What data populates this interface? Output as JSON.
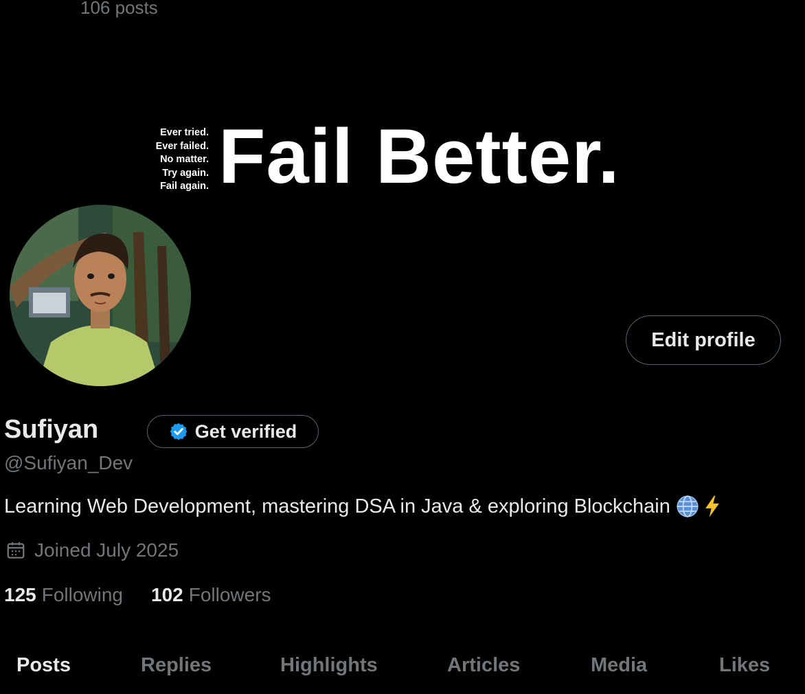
{
  "header": {
    "post_count": "106 posts"
  },
  "banner": {
    "small_lines": [
      "Ever tried.",
      "Ever failed.",
      "No matter.",
      "Try again.",
      "Fail again."
    ],
    "big_text": "Fail Better."
  },
  "profile": {
    "name": "Sufiyan",
    "verify_label": "Get verified",
    "handle": "@Sufiyan_Dev",
    "bio": "Learning Web Development, mastering DSA in Java & exploring Blockchain",
    "bio_emojis": [
      "globe-emoji",
      "lightning-emoji"
    ],
    "joined": "Joined July 2025",
    "edit_label": "Edit profile"
  },
  "stats": {
    "following_count": "125",
    "following_label": "Following",
    "followers_count": "102",
    "followers_label": "Followers"
  },
  "tabs": [
    {
      "label": "Posts",
      "active": true
    },
    {
      "label": "Replies"
    },
    {
      "label": "Highlights"
    },
    {
      "label": "Articles"
    },
    {
      "label": "Media"
    },
    {
      "label": "Likes"
    }
  ],
  "colors": {
    "background": "#000000",
    "text": "#e7e9ea",
    "muted": "#71767b",
    "border": "#536471",
    "verified_blue": "#1d9bf0"
  }
}
